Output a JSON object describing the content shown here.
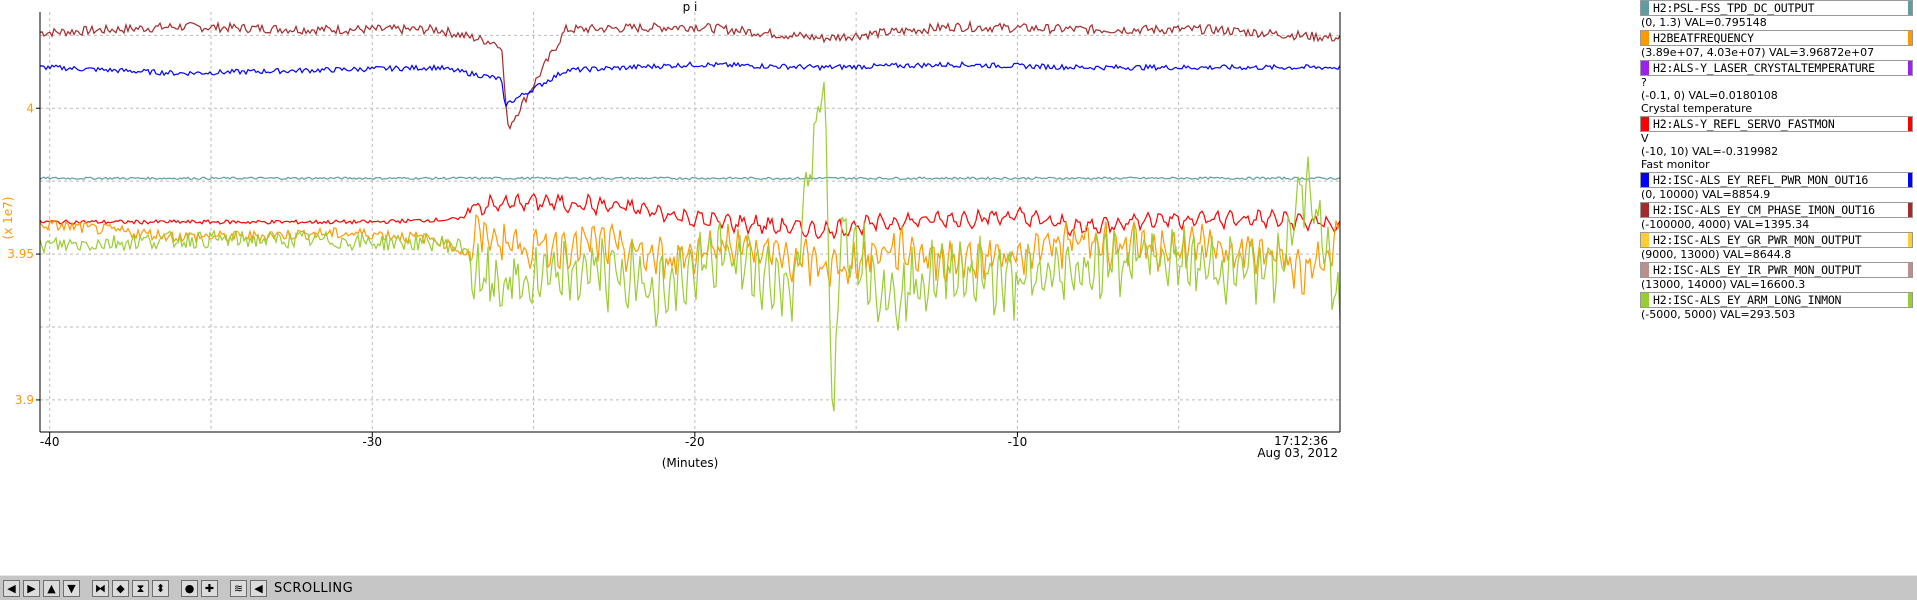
{
  "plot": {
    "title": "p i",
    "y_unit_label": "(x 1e7)",
    "x_label": "(Minutes)",
    "time_label": "17:12:36",
    "date_label": "Aug 03, 2012"
  },
  "chart_data": {
    "type": "line",
    "title": "p i",
    "xlabel": "(Minutes)",
    "ylabel": "(x 1e7)",
    "xlim": [
      -40.3,
      0
    ],
    "ylim": [
      3.889,
      4.033
    ],
    "x_ticks": [
      -40,
      -30,
      -20,
      -10
    ],
    "x_tick_labels": [
      "-40",
      "-30",
      "-20",
      "-10"
    ],
    "y_ticks": [
      4.0,
      3.95,
      3.9
    ],
    "y_tick_labels": [
      "4",
      "3.95",
      "3.9"
    ],
    "grid": true,
    "legend_placement": "right",
    "series": [
      {
        "name": "H2:PSL-FSS_TPD_DC_OUTPUT",
        "color": "#a52a2a",
        "x": [
          -40,
          -36,
          -32,
          -28,
          -26,
          -25.8,
          -24,
          -20,
          -16,
          -12,
          -8,
          -4,
          0
        ],
        "y": [
          4.026,
          4.028,
          4.027,
          4.027,
          4.022,
          3.993,
          4.027,
          4.028,
          4.024,
          4.028,
          4.027,
          4.027,
          4.024
        ]
      },
      {
        "name": "H2BEATFREQUENCY",
        "color": "#0000ff",
        "x": [
          -40,
          -36,
          -32,
          -28,
          -26,
          -25.9,
          -24,
          -20,
          -16,
          -12,
          -8,
          -4,
          0
        ],
        "y": [
          4.014,
          4.012,
          4.013,
          4.014,
          4.01,
          4.001,
          4.013,
          4.015,
          4.014,
          4.015,
          4.014,
          4.014,
          4.014
        ]
      },
      {
        "name": "H2:ALS-Y_LASER_CRYSTALTEMPERATURE",
        "color": "#5f9ea0",
        "x": [
          -40,
          -30,
          -20,
          -10,
          0
        ],
        "y": [
          3.976,
          3.976,
          3.976,
          3.976,
          3.976
        ]
      },
      {
        "name": "H2:ALS-Y_REFL_SERVO_FASTMON",
        "color": "#ff0000",
        "x": [
          -40,
          -35,
          -30,
          -27.2,
          -27,
          -25,
          -22,
          -20,
          -18,
          -16,
          -14,
          -12,
          -10,
          -8,
          -6,
          -4,
          -2,
          0
        ],
        "y": [
          3.961,
          3.961,
          3.961,
          3.962,
          3.966,
          3.968,
          3.966,
          3.962,
          3.96,
          3.958,
          3.961,
          3.962,
          3.963,
          3.959,
          3.962,
          3.962,
          3.962,
          3.96
        ]
      },
      {
        "name": "H2:ISC-ALS_EY_REFL_PWR_MON_OUT16",
        "color": "#ff9900",
        "x": [
          -40,
          -38,
          -36,
          -34,
          -32,
          -30,
          -28,
          -27,
          -26.8,
          -25,
          -23,
          -21,
          -19,
          -17,
          -15.5,
          -14,
          -12,
          -10,
          -8,
          -6,
          -4,
          -2,
          -1,
          0
        ],
        "y": [
          3.96,
          3.958,
          3.956,
          3.956,
          3.957,
          3.957,
          3.955,
          3.95,
          3.957,
          3.952,
          3.954,
          3.948,
          3.954,
          3.948,
          3.945,
          3.952,
          3.948,
          3.95,
          3.955,
          3.952,
          3.952,
          3.95,
          3.942,
          3.958
        ]
      },
      {
        "name": "H2:ISC-ALS_EY_CM_PHASE_IMON_OUT16",
        "color": "#9acd32",
        "x": [
          -40,
          -38,
          -36,
          -34,
          -32,
          -30,
          -28,
          -27,
          -26.8,
          -25,
          -23,
          -21,
          -19,
          -17,
          -16,
          -15.7,
          -15.5,
          -14,
          -12,
          -10,
          -8,
          -6,
          -4,
          -2,
          -1,
          0
        ],
        "y": [
          3.953,
          3.954,
          3.955,
          3.955,
          3.955,
          3.954,
          3.954,
          3.952,
          3.94,
          3.94,
          3.945,
          3.938,
          3.95,
          3.938,
          4.008,
          3.89,
          3.96,
          3.935,
          3.945,
          3.94,
          3.945,
          3.95,
          3.945,
          3.945,
          3.975,
          3.93
        ]
      }
    ]
  },
  "legend": [
    {
      "name": "H2:PSL-FSS_TPD_DC_OUTPUT",
      "range": "(0, 1.3) VAL=0.795148",
      "extra": [],
      "color": "#5f9ea0",
      "right_color": "#5f9ea0"
    },
    {
      "name": "H2BEATFREQUENCY",
      "range": "(3.89e+07, 4.03e+07) VAL=3.96872e+07",
      "extra": [],
      "color": "#ff9900",
      "right_color": "#ff9900"
    },
    {
      "name": "H2:ALS-Y_LASER_CRYSTALTEMPERATURE",
      "range": "?",
      "extra": [
        "(-0.1, 0) VAL=0.0180108",
        "Crystal temperature"
      ],
      "color": "#a020f0",
      "right_color": "#a020f0"
    },
    {
      "name": "H2:ALS-Y_REFL_SERVO_FASTMON",
      "range": "V",
      "extra": [
        "(-10, 10) VAL=-0.319982",
        "Fast monitor"
      ],
      "color": "#ff0000",
      "right_color": "#ff0000"
    },
    {
      "name": "H2:ISC-ALS_EY_REFL_PWR_MON_OUT16",
      "range": "(0, 10000) VAL=8854.9",
      "extra": [],
      "color": "#0000ff",
      "right_color": "#0000ff"
    },
    {
      "name": "H2:ISC-ALS_EY_CM_PHASE_IMON_OUT16",
      "range": "(-100000, 4000) VAL=1395.34",
      "extra": [],
      "color": "#a52a2a",
      "right_color": "#a52a2a"
    },
    {
      "name": "H2:ISC-ALS_EY_GR_PWR_MON_OUTPUT",
      "range": "(9000, 13000) VAL=8644.8",
      "extra": [],
      "color": "#ffcc33",
      "right_color": "#ffcc33"
    },
    {
      "name": "H2:ISC-ALS_EY_IR_PWR_MON_OUTPUT",
      "range": "(13000, 14000) VAL=16600.3",
      "extra": [],
      "color": "#bc8f8f",
      "right_color": "#bc8f8f"
    },
    {
      "name": "H2:ISC-ALS_EY_ARM_LONG_INMON",
      "range": "(-5000, 5000) VAL=293.503",
      "extra": [],
      "color": "#9acd32",
      "right_color": "#9acd32"
    }
  ],
  "toolbar": {
    "buttons": [
      {
        "name": "scroll-left-button",
        "glyph": "◀"
      },
      {
        "name": "scroll-right-button",
        "glyph": "▶"
      },
      {
        "name": "scroll-up-button",
        "glyph": "▲"
      },
      {
        "name": "scroll-down-button",
        "glyph": "▼"
      },
      {
        "name": "zoom-in-x-button",
        "glyph": "⧓"
      },
      {
        "name": "zoom-out-x-button",
        "glyph": "◆"
      },
      {
        "name": "zoom-in-y-button",
        "glyph": "⧗"
      },
      {
        "name": "zoom-out-y-button",
        "glyph": "⬍"
      },
      {
        "name": "record-button",
        "glyph": "●"
      },
      {
        "name": "add-button",
        "glyph": "✚"
      },
      {
        "name": "config-button",
        "glyph": "≋"
      },
      {
        "name": "mode-toggle-button",
        "glyph": "◀"
      }
    ],
    "mode": "SCROLLING"
  }
}
